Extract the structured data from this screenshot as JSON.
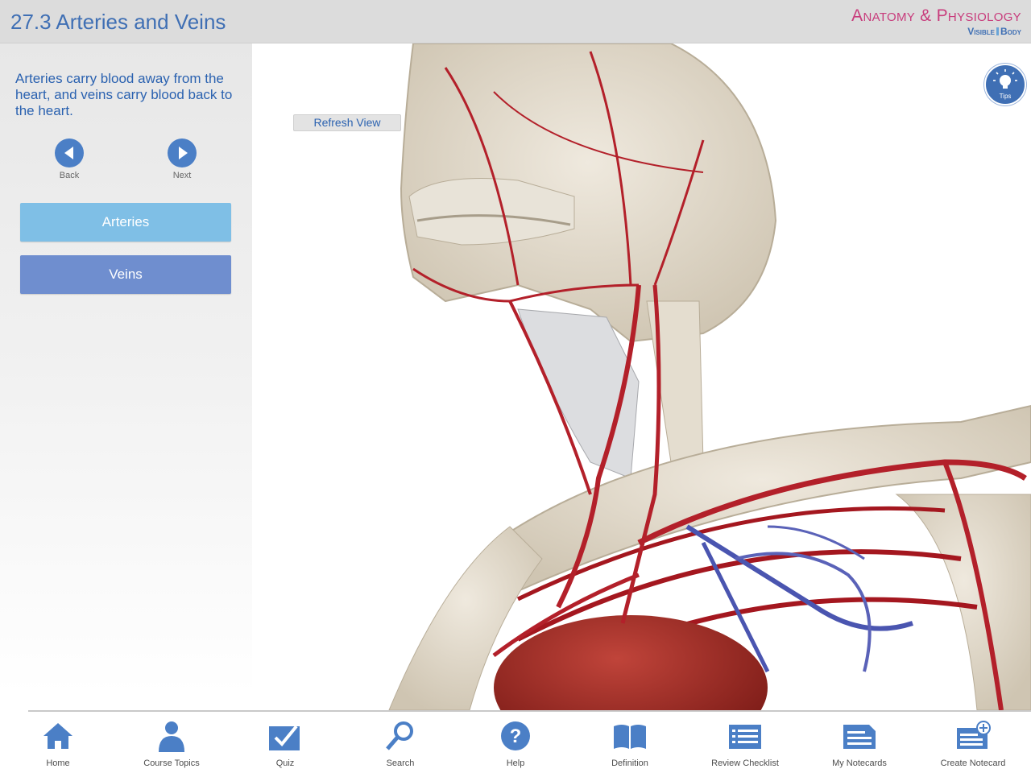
{
  "header": {
    "title": "27.3 Arteries and Veins",
    "brand_main": "Anatomy & Physiology",
    "brand_sub_left": "Visible",
    "brand_sub_right": "Body"
  },
  "sidebar": {
    "description": "Arteries carry blood away from the heart, and veins carry blood back to the heart.",
    "back_label": "Back",
    "next_label": "Next",
    "buttons": [
      {
        "label": "Arteries",
        "color": "#7fbfe6"
      },
      {
        "label": "Veins",
        "color": "#6f8ecf"
      }
    ]
  },
  "viewer": {
    "refresh_label": "Refresh View",
    "tips_label": "Tips"
  },
  "toolbar": {
    "items": [
      {
        "label": "Home",
        "icon": "home-icon"
      },
      {
        "label": "Course Topics",
        "icon": "person-icon"
      },
      {
        "label": "Quiz",
        "icon": "check-icon"
      },
      {
        "label": "Search",
        "icon": "search-icon"
      },
      {
        "label": "Help",
        "icon": "question-icon"
      },
      {
        "label": "Definition",
        "icon": "book-icon"
      },
      {
        "label": "Review Checklist",
        "icon": "checklist-icon"
      },
      {
        "label": "My Notecards",
        "icon": "notecards-icon"
      },
      {
        "label": "Create Notecard",
        "icon": "create-notecard-icon"
      }
    ]
  },
  "colors": {
    "accent": "#3f6fb4",
    "brand_pink": "#c83c7c",
    "artery": "#b3202a",
    "vein": "#4a55b0",
    "bone": "#e4ddcf"
  }
}
